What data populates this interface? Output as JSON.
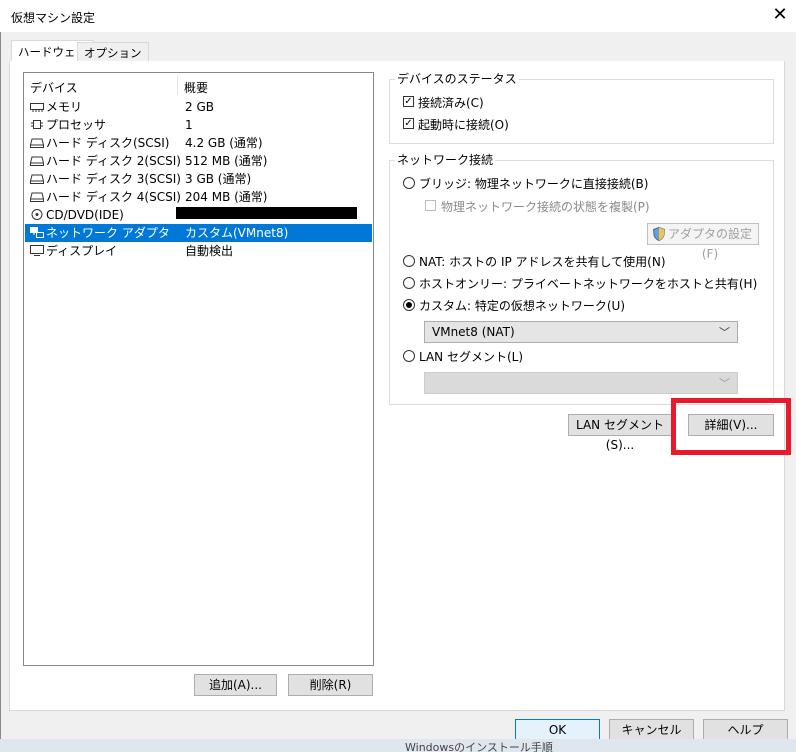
{
  "window": {
    "title": "仮想マシン設定"
  },
  "tabs": [
    {
      "label": "ハードウェア"
    },
    {
      "label": "オプション"
    }
  ],
  "device_list": {
    "headers": {
      "device": "デバイス",
      "summary": "概要"
    },
    "rows": [
      {
        "name": "メモリ",
        "summary": "2 GB",
        "icon": "memory-icon"
      },
      {
        "name": "プロセッサ",
        "summary": "1",
        "icon": "processor-icon"
      },
      {
        "name": "ハード ディスク(SCSI)",
        "summary": "4.2 GB (通常)",
        "icon": "hard-disk-icon"
      },
      {
        "name": "ハード ディスク 2(SCSI)",
        "summary": "512 MB (通常)",
        "icon": "hard-disk-icon"
      },
      {
        "name": "ハード ディスク 3(SCSI)",
        "summary": "3 GB (通常)",
        "icon": "hard-disk-icon"
      },
      {
        "name": "ハード ディスク 4(SCSI)",
        "summary": "204 MB (通常)",
        "icon": "hard-disk-icon"
      },
      {
        "name": "CD/DVD(IDE)",
        "summary": "",
        "icon": "cd-dvd-icon"
      },
      {
        "name": "ネットワーク アダプタ",
        "summary": "カスタム(VMnet8)",
        "icon": "network-adapter-icon",
        "selected": true
      },
      {
        "name": "ディスプレイ",
        "summary": "自動検出",
        "icon": "display-icon"
      }
    ],
    "add_button": "追加(A)...",
    "remove_button": "削除(R)"
  },
  "device_status": {
    "legend": "デバイスのステータス",
    "connected": {
      "label": "接続済み(C)",
      "checked": true
    },
    "connect_at_power_on": {
      "label": "起動時に接続(O)",
      "checked": true
    }
  },
  "network": {
    "legend": "ネットワーク接続",
    "bridged": {
      "label": "ブリッジ: 物理ネットワークに直接接続(B)",
      "selected": false
    },
    "replicate": {
      "label": "物理ネットワーク接続の状態を複製(P)",
      "checked": false
    },
    "adapter_settings_button": "アダプタの設定(F)",
    "nat": {
      "label": "NAT: ホストの IP アドレスを共有して使用(N)",
      "selected": false
    },
    "host_only": {
      "label": "ホストオンリー: プライベートネットワークをホストと共有(H)",
      "selected": false
    },
    "custom": {
      "label": "カスタム: 特定の仮想ネットワーク(U)",
      "selected": true
    },
    "custom_select_value": "VMnet8 (NAT)",
    "lan_segment": {
      "label": "LAN セグメント(L)",
      "selected": false
    },
    "lan_segment_select_value": "",
    "lan_segments_button": "LAN セグメント(S)...",
    "advanced_button": "詳細(V)..."
  },
  "footer": {
    "ok": "OK",
    "cancel": "キャンセル",
    "help": "ヘルプ"
  },
  "status_bar": {
    "text": "Windowsのインストール手順"
  },
  "colors": {
    "selection": "#0078d7",
    "highlight_box": "#e8192c"
  }
}
